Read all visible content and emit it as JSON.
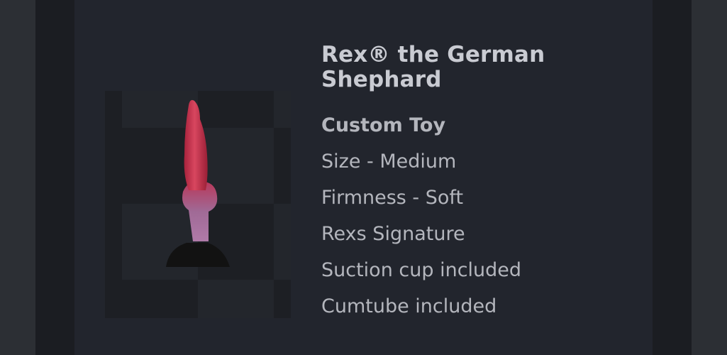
{
  "product": {
    "title": "Rex® the German Shephard",
    "subtitle": "Custom Toy",
    "details": [
      "Size - Medium",
      "Firmness - Soft",
      "Rexs Signature",
      "Suction cup included",
      "Cumtube included"
    ],
    "image_icon": "product-photo"
  },
  "colors": {
    "page_background": "#2c2f34",
    "card_background": "#22252d",
    "text": "#b4b6bd",
    "product_pink": "#c8374f",
    "product_base": "#111111"
  }
}
